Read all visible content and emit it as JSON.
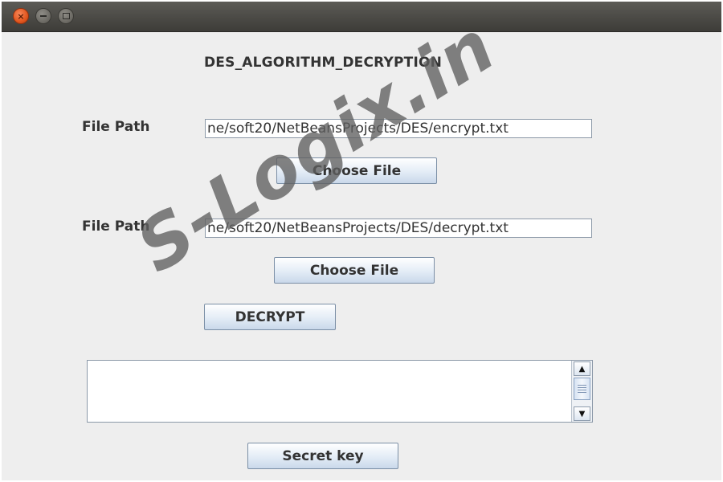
{
  "window": {
    "title_buttons": {
      "close_icon": "close-icon",
      "minimize_icon": "minimize-icon",
      "maximize_icon": "maximize-icon"
    },
    "accent_close": "#e2561e"
  },
  "heading": "DES_ALGORITHM_DECRYPTION",
  "encrypt_section": {
    "label": "File Path",
    "value": "ne/soft20/NetBeansProjects/DES/encrypt.txt",
    "button_label": "Choose File"
  },
  "decrypt_section": {
    "label": "File Path",
    "value": "ne/soft20/NetBeansProjects/DES/decrypt.txt",
    "button_label": "Choose File"
  },
  "decrypt_button_label": "DECRYPT",
  "output_area": {
    "value": ""
  },
  "secret_key_button_label": "Secret key",
  "watermark": "S-Logix.in"
}
